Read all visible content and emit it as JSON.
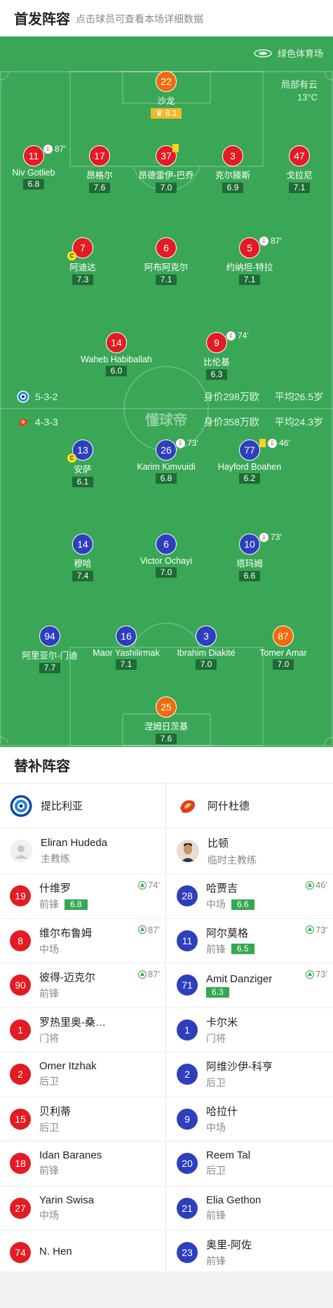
{
  "header": {
    "title": "首发阵容",
    "subtitle": "点击球员可查看本场详细数据"
  },
  "pitch": {
    "venue": "绿色体育场",
    "weather": "局部有云",
    "temperature": "13°C",
    "brand": "懂球帝",
    "colors": {
      "pitch": "#3aa757",
      "home": "#e31b23",
      "away": "#2e3fbd",
      "keeper": "#f06b0c"
    },
    "home_team": {
      "formation": "5-3-2",
      "value": "身价298万欧",
      "avg_age": "平均26.5岁"
    },
    "away_team": {
      "formation": "4-3-3",
      "value": "身价358万欧",
      "avg_age": "平均24.3岁"
    },
    "home_players": [
      {
        "num": "22",
        "name": "沙龙",
        "rating": "8.1",
        "best": true
      },
      {
        "num": "11",
        "name": "Niv Gotlieb",
        "rating": "6.8",
        "sub_min": "87'"
      },
      {
        "num": "17",
        "name": "昂格尔",
        "rating": "7.6"
      },
      {
        "num": "37",
        "name": "昂德雷伊-巴乔",
        "rating": "7.0",
        "yellow": true
      },
      {
        "num": "3",
        "name": "克尔滕斯",
        "rating": "6.9"
      },
      {
        "num": "47",
        "name": "戈拉尼",
        "rating": "7.1"
      },
      {
        "num": "7",
        "name": "阿迪达",
        "rating": "7.3",
        "captain": "C"
      },
      {
        "num": "6",
        "name": "阿布阿克尔",
        "rating": "7.1"
      },
      {
        "num": "5",
        "name": "约纳坦-特拉",
        "rating": "7.1",
        "sub_min": "87'"
      },
      {
        "num": "14",
        "name": "Waheb Habiballah",
        "rating": "6.0"
      },
      {
        "num": "9",
        "name": "比伦基",
        "rating": "6.3",
        "sub_min": "74'"
      }
    ],
    "away_players": [
      {
        "num": "13",
        "name": "安萨",
        "rating": "6.1",
        "captain": "C"
      },
      {
        "num": "26",
        "name": "Karim Kimvuidi",
        "rating": "6.8",
        "sub_min": "73'"
      },
      {
        "num": "77",
        "name": "Hayford Boahen",
        "rating": "6.2",
        "sub_min": "46'",
        "yellow": true
      },
      {
        "num": "14",
        "name": "穆哈",
        "rating": "7.4"
      },
      {
        "num": "6",
        "name": "Victor Ochayi",
        "rating": "7.0"
      },
      {
        "num": "10",
        "name": "塔玛姆",
        "rating": "6.6",
        "sub_min": "73'"
      },
      {
        "num": "94",
        "name": "阿里亚尔-门迪",
        "rating": "7.7"
      },
      {
        "num": "16",
        "name": "Maor Yashilirmak",
        "rating": "7.1"
      },
      {
        "num": "3",
        "name": "Ibrahim Diakité",
        "rating": "7.0"
      },
      {
        "num": "87",
        "name": "Tomer Amar",
        "rating": "7.0"
      },
      {
        "num": "25",
        "name": "涅姆日茨基",
        "rating": "7.6"
      }
    ]
  },
  "subs": {
    "title": "替补阵容",
    "home": {
      "team": "提比利亚",
      "coach": {
        "name": "Eliran Hudeda",
        "role": "主教练"
      },
      "players": [
        {
          "num": "19",
          "name": "什维罗",
          "pos": "前锋",
          "rating": "6.8",
          "in": "74'"
        },
        {
          "num": "8",
          "name": "维尔布鲁姆",
          "pos": "中场",
          "in": "87'"
        },
        {
          "num": "90",
          "name": "彼得-迈克尔",
          "pos": "前锋",
          "in": "87'"
        },
        {
          "num": "1",
          "name": "罗热里奥-桑…",
          "pos": "门将"
        },
        {
          "num": "2",
          "name": "Omer Itzhak",
          "pos": "后卫"
        },
        {
          "num": "15",
          "name": "贝利蒂",
          "pos": "后卫"
        },
        {
          "num": "18",
          "name": "Idan Baranes",
          "pos": "前锋"
        },
        {
          "num": "27",
          "name": "Yarin Swisa",
          "pos": "中场"
        },
        {
          "num": "74",
          "name": "N. Hen",
          "pos": ""
        }
      ]
    },
    "away": {
      "team": "阿什杜德",
      "coach": {
        "name": "比顿",
        "role": "临时主教练"
      },
      "players": [
        {
          "num": "28",
          "name": "哈贾吉",
          "pos": "中场",
          "rating": "6.6",
          "in": "46'"
        },
        {
          "num": "11",
          "name": "阿尔莫格",
          "pos": "前锋",
          "rating": "6.5",
          "in": "73'"
        },
        {
          "num": "71",
          "name": "Amit Danziger",
          "pos": "",
          "rating": "6.3",
          "in": "73'"
        },
        {
          "num": "1",
          "name": "卡尔米",
          "pos": "门将"
        },
        {
          "num": "2",
          "name": "阿维沙伊-科亨",
          "pos": "后卫"
        },
        {
          "num": "9",
          "name": "哈拉什",
          "pos": "中场"
        },
        {
          "num": "20",
          "name": "Reem Tal",
          "pos": "后卫"
        },
        {
          "num": "21",
          "name": "Elia Gethon",
          "pos": "前锋"
        },
        {
          "num": "23",
          "name": "奥里-阿佐",
          "pos": "前锋"
        }
      ]
    }
  }
}
